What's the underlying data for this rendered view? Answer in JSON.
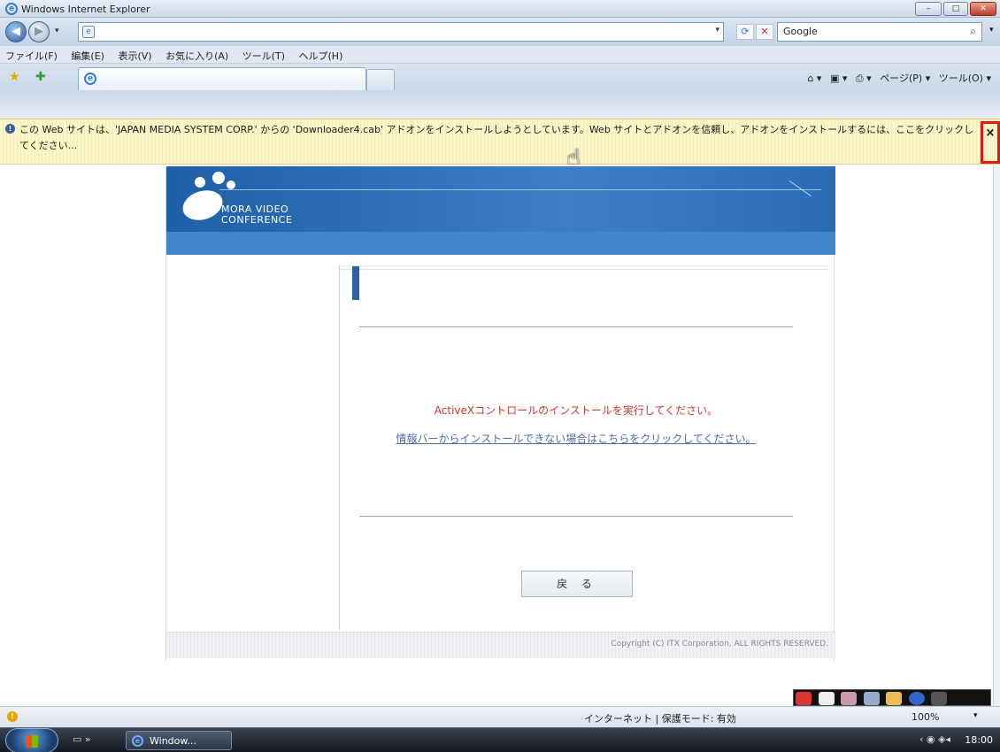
{
  "window": {
    "title": "Windows Internet Explorer",
    "minimize": "–",
    "maximize": "□",
    "close": "✕"
  },
  "address": {
    "url": "",
    "search_value": "Google"
  },
  "menu": [
    "ファイル(F)",
    "編集(E)",
    "表示(V)",
    "お気に入り(A)",
    "ツール(T)",
    "ヘルプ(H)"
  ],
  "command_bar": {
    "page": "ページ(P) ▾",
    "tools": "ツール(O) ▾"
  },
  "info_bar": {
    "message": "この Web サイトは、'JAPAN MEDIA SYSTEM CORP.' からの 'Downloader4.cab' アドオンをインストールしようとしています。Web サイトとアドオンを信頼し、アドオンをインストールするには、ここをクリックしてください...",
    "close": "×"
  },
  "page": {
    "logo_line1": "MORA VIDEO",
    "logo_line2": "CONFERENCE",
    "instruction": "ActiveXコントロールのインストールを実行してください。",
    "link": "情報バーからインストールできない場合はこちらをクリックしてください。",
    "back_button": "戻 る",
    "copyright": "Copyright (C) ITX Corporation, ALL RIGHTS RESERVED."
  },
  "status": {
    "zone": "インターネット | 保護モード: 有効",
    "zoom": "100%"
  },
  "taskbar": {
    "item": "Window...",
    "time": "18:00"
  },
  "colors": {
    "accent": "#2f5fa8",
    "instruction": "#d0342c",
    "link": "#4a6da7",
    "highlight": "#e01818"
  }
}
